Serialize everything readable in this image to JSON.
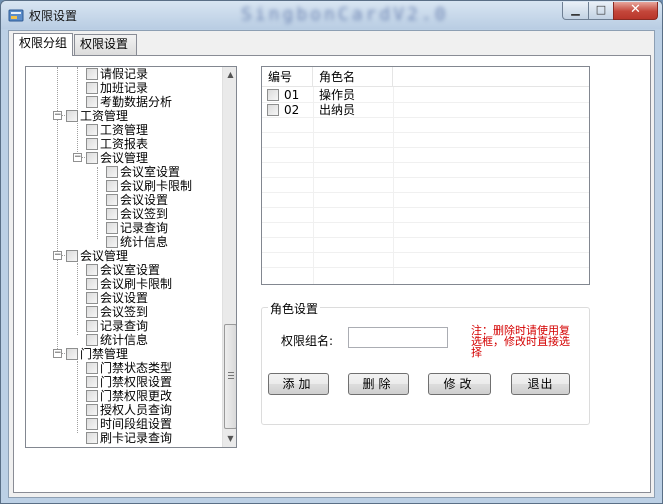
{
  "window": {
    "title": "权限设置",
    "blurred_title": "SingbonCardV2.0"
  },
  "tabs": [
    {
      "label": "权限分组"
    },
    {
      "label": "权限设置"
    }
  ],
  "tree": {
    "items": [
      {
        "label": "请假记录"
      },
      {
        "label": "加班记录"
      },
      {
        "label": "考勤数据分析"
      },
      {
        "label": "工资管理"
      },
      {
        "label": "工资管理"
      },
      {
        "label": "工资报表"
      },
      {
        "label": "会议管理"
      },
      {
        "label": "会议室设置"
      },
      {
        "label": "会议刷卡限制"
      },
      {
        "label": "会议设置"
      },
      {
        "label": "会议签到"
      },
      {
        "label": "记录查询"
      },
      {
        "label": "统计信息"
      },
      {
        "label": "会议管理"
      },
      {
        "label": "会议室设置"
      },
      {
        "label": "会议刷卡限制"
      },
      {
        "label": "会议设置"
      },
      {
        "label": "会议签到"
      },
      {
        "label": "记录查询"
      },
      {
        "label": "统计信息"
      },
      {
        "label": "门禁管理"
      },
      {
        "label": "门禁状态类型"
      },
      {
        "label": "门禁权限设置"
      },
      {
        "label": "门禁权限更改"
      },
      {
        "label": "授权人员查询"
      },
      {
        "label": "时间段组设置"
      },
      {
        "label": "刷卡记录查询"
      }
    ],
    "expanders": [
      "−",
      "−",
      "−",
      "−"
    ]
  },
  "list": {
    "columns": [
      "编号",
      "角色名"
    ],
    "rows": [
      {
        "id": "01",
        "name": "操作员"
      },
      {
        "id": "02",
        "name": "出纳员"
      }
    ]
  },
  "role_settings": {
    "group_title": "角色设置",
    "field_label": "权限组名:",
    "field_value": "",
    "note": "注：删除时请使用复选框，修改时直接选择",
    "buttons": {
      "add": "添加",
      "delete": "删除",
      "modify": "修改",
      "exit": "退出"
    }
  },
  "colors": {
    "note": "#d40000",
    "close_button": "#c4463a"
  }
}
